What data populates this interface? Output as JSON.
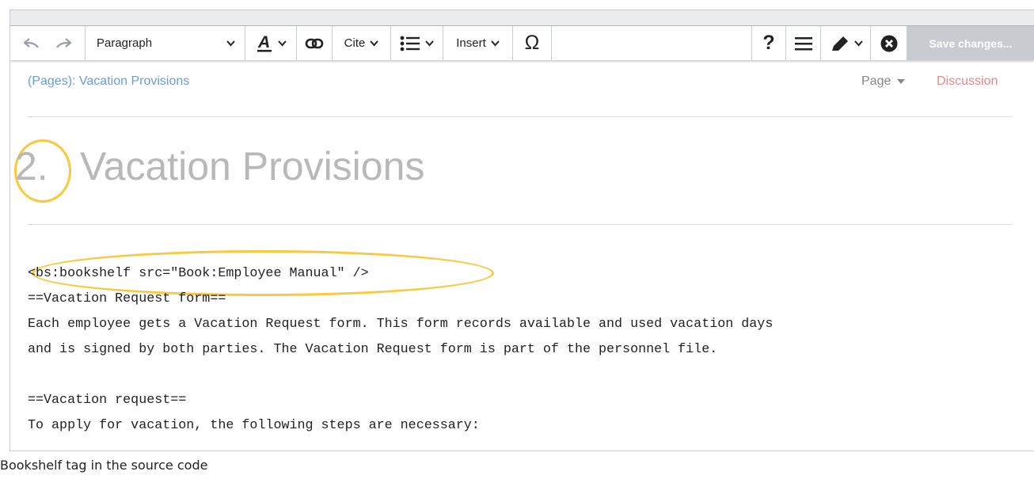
{
  "toolbar": {
    "paragraph_label": "Paragraph",
    "cite_label": "Cite",
    "insert_label": "Insert",
    "omega_symbol": "Ω",
    "help_symbol": "?",
    "save_label": "Save changes..."
  },
  "breadcrumb": {
    "text": "(Pages):  Vacation Provisions"
  },
  "tabs": {
    "page_label": "Page",
    "discussion_label": "Discussion"
  },
  "heading": {
    "number": "2.",
    "title": "Vacation Provisions"
  },
  "source": {
    "lines": [
      "<bs:bookshelf src=\"Book:Employee Manual\" />",
      "==Vacation Request form==",
      "Each employee gets a Vacation Request form. This form records available and used vacation days",
      "and is signed by both parties. The Vacation Request form is part of the personnel file.",
      "",
      "==Vacation request==",
      "To apply for vacation, the following steps are necessary:"
    ]
  },
  "caption": "Bookshelf tag in the source code",
  "colors": {
    "highlight_ring": "#fbc83d",
    "link": "#6b9bd9",
    "discussion_link": "#e6878a",
    "save_disabled": "#c8ccd1"
  }
}
